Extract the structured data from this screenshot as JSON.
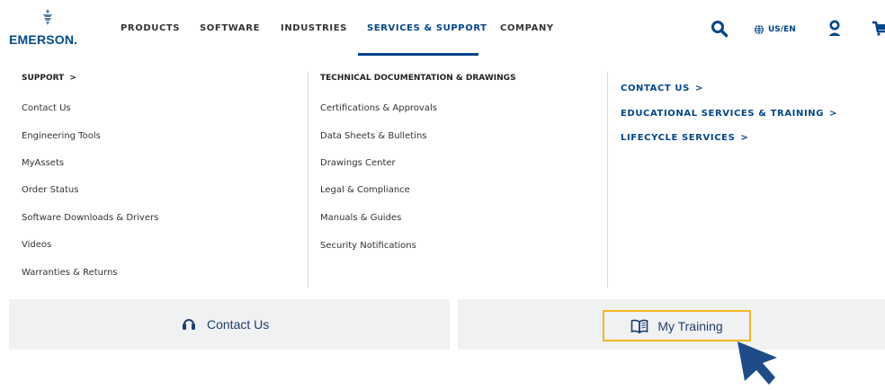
{
  "header": {
    "logo_text": "EMERSON.",
    "nav": [
      {
        "label": "PRODUCTS"
      },
      {
        "label": "SOFTWARE"
      },
      {
        "label": "INDUSTRIES"
      },
      {
        "label": "SERVICES & SUPPORT"
      },
      {
        "label": "COMPANY"
      }
    ],
    "region_label": "US/EN"
  },
  "menu": {
    "support": {
      "heading": "SUPPORT",
      "links": [
        "Contact Us",
        "Engineering Tools",
        "MyAssets",
        "Order Status",
        "Software Downloads & Drivers",
        "Videos",
        "Warranties & Returns"
      ]
    },
    "tech_docs": {
      "heading": "TECHNICAL DOCUMENTATION & DRAWINGS",
      "links": [
        "Certifications & Approvals",
        "Data Sheets & Bulletins",
        "Drawings Center",
        "Legal & Compliance",
        "Manuals & Guides",
        "Security Notifications"
      ]
    },
    "featured": [
      {
        "label": "CONTACT US"
      },
      {
        "label": "EDUCATIONAL SERVICES & TRAINING"
      },
      {
        "label": "LIFECYCLE SERVICES"
      }
    ]
  },
  "bottom": {
    "contact_label": "Contact Us",
    "training_label": "My Training"
  },
  "colors": {
    "brand_blue": "#00468b",
    "highlight": "#f2b821",
    "bar_bg": "#f0f1f2"
  },
  "icons": [
    "emerson-logo-icon",
    "search-icon",
    "globe-icon",
    "user-icon",
    "cart-icon",
    "chevron-right-icon",
    "headset-icon",
    "book-icon",
    "cursor-arrow-icon"
  ]
}
